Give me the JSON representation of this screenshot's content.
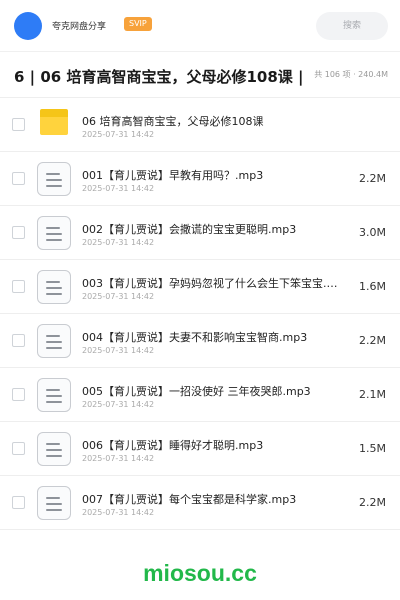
{
  "header": {
    "app_name": "夸克网盘分享",
    "badge": "SVIP",
    "search_placeholder": "搜索",
    "avatar_color": "#2e7cf6",
    "badge_color": "#f7a23b"
  },
  "folder": {
    "title": "6 | 06 培育高智商宝宝，父母必修108课 |",
    "summary": "共 106 项 · 240.4M"
  },
  "files": [
    {
      "icon": "folder-icon",
      "name": "06 培育高智商宝宝，父母必修108课",
      "date": "2025-07-31 14:42",
      "size": ""
    },
    {
      "icon": "audio-file-icon",
      "name": "001【育儿贾说】早教有用吗？.mp3",
      "date": "2025-07-31 14:42",
      "size": "2.2M"
    },
    {
      "icon": "audio-file-icon",
      "name": "002【育儿贾说】会撒谎的宝宝更聪明.mp3",
      "date": "2025-07-31 14:42",
      "size": "3.0M"
    },
    {
      "icon": "audio-file-icon",
      "name": "003【育儿贾说】孕妈妈忽视了什么会生下笨宝宝.m…",
      "date": "2025-07-31 14:42",
      "size": "1.6M"
    },
    {
      "icon": "audio-file-icon",
      "name": "004【育儿贾说】夫妻不和影响宝宝智商.mp3",
      "date": "2025-07-31 14:42",
      "size": "2.2M"
    },
    {
      "icon": "audio-file-icon",
      "name": "005【育儿贾说】一招没使好 三年夜哭郎.mp3",
      "date": "2025-07-31 14:42",
      "size": "2.1M"
    },
    {
      "icon": "audio-file-icon",
      "name": "006【育儿贾说】睡得好才聪明.mp3",
      "date": "2025-07-31 14:42",
      "size": "1.5M"
    },
    {
      "icon": "audio-file-icon",
      "name": "007【育儿贾说】每个宝宝都是科学家.mp3",
      "date": "2025-07-31 14:42",
      "size": "2.2M"
    }
  ],
  "watermark": "miosou.cc",
  "colors": {
    "watermark": "#22b84a",
    "folder": "#ffd33d"
  }
}
